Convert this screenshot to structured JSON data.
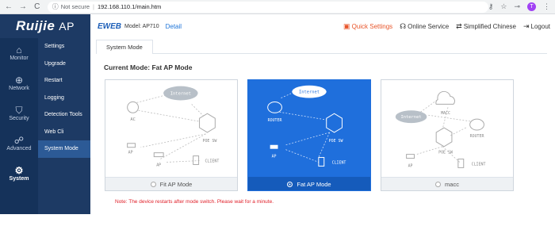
{
  "browser": {
    "not_secure_label": "Not secure",
    "url": "192.168.110.1/main.htm"
  },
  "header": {
    "brand_logo": "Ruijie",
    "brand_suffix": "AP",
    "eweb_logo": "EWEB",
    "model_label": "Model: AP710",
    "detail_link": "Detail",
    "quick_settings": "Quick Settings",
    "online_service": "Online Service",
    "language": "Simplified Chinese",
    "logout": "Logout"
  },
  "rail": [
    {
      "label": "Monitor",
      "icon": "home-icon"
    },
    {
      "label": "Network",
      "icon": "globe-icon"
    },
    {
      "label": "Security",
      "icon": "shield-icon"
    },
    {
      "label": "Advanced",
      "icon": "users-icon"
    },
    {
      "label": "System",
      "icon": "gear-icon"
    }
  ],
  "menu": [
    "Settings",
    "Upgrade",
    "Restart",
    "Logging",
    "Detection Tools",
    "Web Cli",
    "System Mode"
  ],
  "main": {
    "tab": "System Mode",
    "current_mode": "Current Mode: Fat AP Mode",
    "note": "Note: The device restarts after mode switch. Please wait for a minute."
  },
  "modes": [
    {
      "label": "Fit AP Mode",
      "selected": false
    },
    {
      "label": "Fat AP Mode",
      "selected": true
    },
    {
      "label": "macc",
      "selected": false
    }
  ],
  "diagram_labels": {
    "internet": "Internet",
    "ac": "AC",
    "poe_sw": "POE SW",
    "ap": "AP",
    "client": "CLIENT",
    "router": "ROUTER",
    "macc": "MACC"
  },
  "colors": {
    "sidebar": "#1d3a64",
    "accent": "#1f6fdc",
    "quick_settings": "#e8552a",
    "note": "#e0202a"
  }
}
